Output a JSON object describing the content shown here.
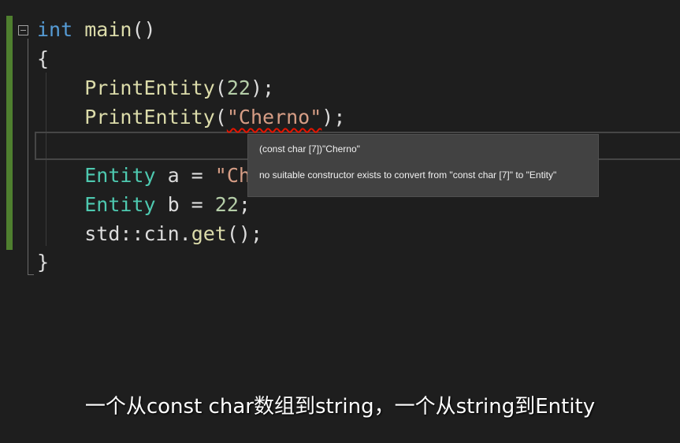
{
  "code": {
    "line1": {
      "kw": "int",
      "fn": "main",
      "rest": "()"
    },
    "line2": {
      "brace": "{"
    },
    "line3": {
      "fn": "PrintEntity",
      "open": "(",
      "num": "22",
      "close": ");"
    },
    "line4": {
      "fn": "PrintEntity",
      "open": "(",
      "str": "\"Cherno\"",
      "close": ");"
    },
    "line6": {
      "type": "Entity",
      "rest": " a = ",
      "str": "\"Ch"
    },
    "line7": {
      "type": "Entity",
      "rest": " b = ",
      "num": "22",
      "close": ";"
    },
    "line8": {
      "ns": "std::cin.",
      "fn": "get",
      "rest": "();"
    },
    "line9": {
      "brace": "}"
    }
  },
  "tooltip": {
    "signature": "(const char [7])\"Cherno\"",
    "message": "no suitable constructor exists to convert from \"const char [7]\" to \"Entity\""
  },
  "subtitle": "一个从const char数组到string，一个从string到Entity",
  "colors": {
    "background": "#1e1e1e",
    "keyword": "#569cd6",
    "function": "#dcdcaa",
    "type": "#4ec9b0",
    "number": "#b5cea8",
    "string": "#d69d85",
    "error_squiggle": "#e51400",
    "change_bar": "#4f7f2f"
  }
}
